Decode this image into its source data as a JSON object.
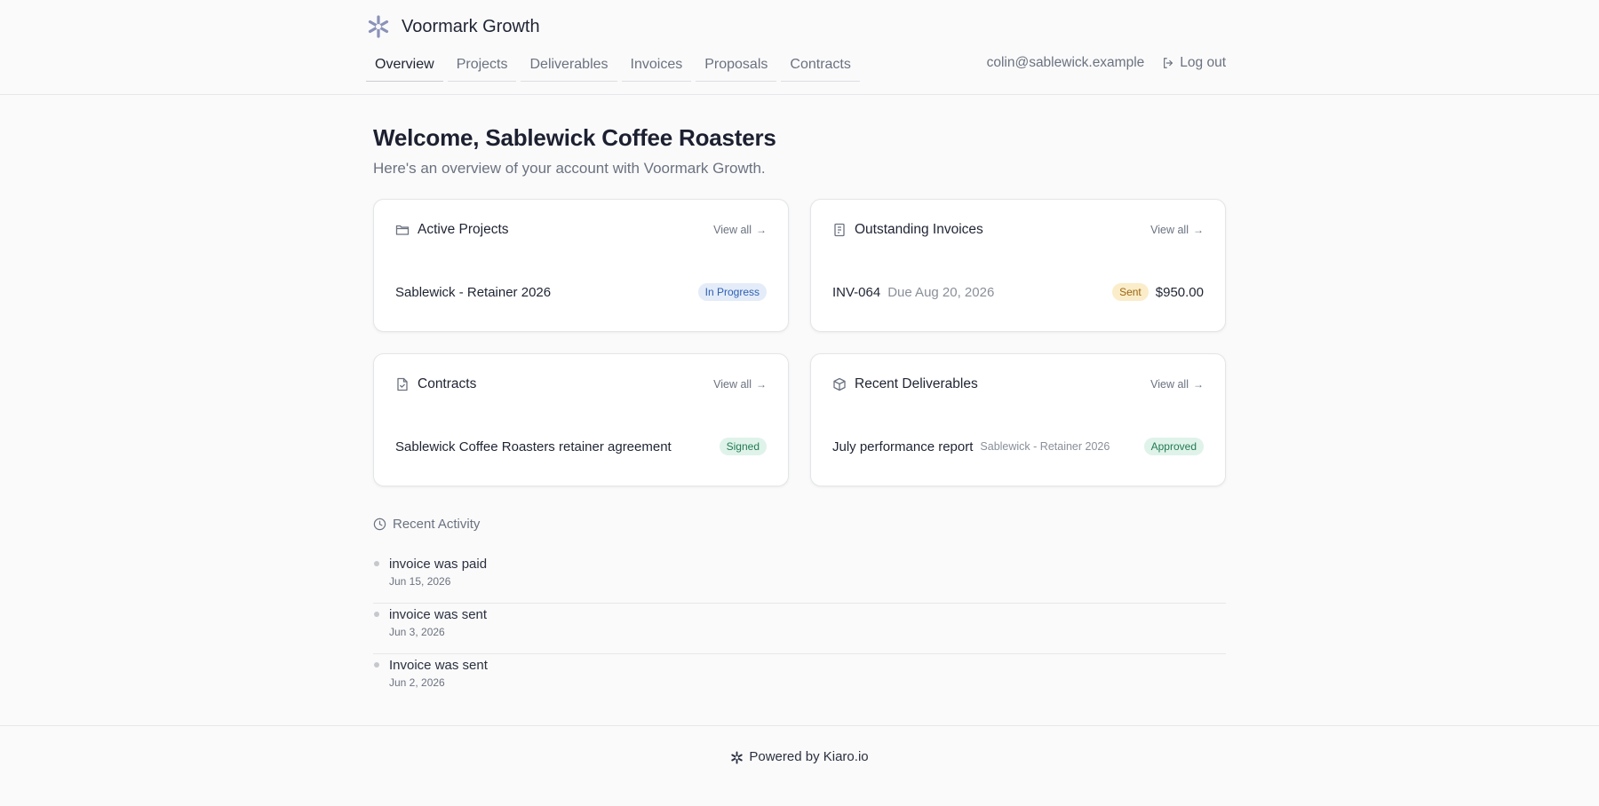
{
  "brand": {
    "name": "Voormark Growth",
    "logo_icon": "asterisk-logo-icon"
  },
  "nav": {
    "items": [
      {
        "label": "Overview",
        "active": true
      },
      {
        "label": "Projects",
        "active": false
      },
      {
        "label": "Deliverables",
        "active": false
      },
      {
        "label": "Invoices",
        "active": false
      },
      {
        "label": "Proposals",
        "active": false
      },
      {
        "label": "Contracts",
        "active": false
      }
    ]
  },
  "user": {
    "email": "colin@sablewick.example",
    "logout_label": "Log out"
  },
  "main": {
    "welcome": "Welcome, Sablewick Coffee Roasters",
    "subtitle": "Here's an overview of your account with Voormark Growth."
  },
  "cards": {
    "projects": {
      "title": "Active Projects",
      "view_all": "View all",
      "row": {
        "name": "Sablewick - Retainer 2026",
        "status": "In Progress"
      }
    },
    "invoices": {
      "title": "Outstanding Invoices",
      "view_all": "View all",
      "row": {
        "number": "INV-064",
        "due": "Due Aug 20, 2026",
        "status": "Sent",
        "amount": "$950.00"
      }
    },
    "contracts": {
      "title": "Contracts",
      "view_all": "View all",
      "row": {
        "name": "Sablewick Coffee Roasters retainer agreement",
        "status": "Signed"
      }
    },
    "deliverables": {
      "title": "Recent Deliverables",
      "view_all": "View all",
      "row": {
        "name": "July performance report",
        "project": "Sablewick - Retainer 2026",
        "status": "Approved"
      }
    }
  },
  "activity": {
    "title": "Recent Activity",
    "items": [
      {
        "title": "invoice was paid",
        "date": "Jun 15, 2026"
      },
      {
        "title": "invoice was sent",
        "date": "Jun 3, 2026"
      },
      {
        "title": "Invoice was sent",
        "date": "Jun 2, 2026"
      }
    ]
  },
  "footer": {
    "text": "Powered by Kiaro.io"
  },
  "colors": {
    "accent": "#8a92b8",
    "badge_blue": "#2f5fb3",
    "badge_green": "#237a52",
    "badge_amber": "#9a6511"
  }
}
